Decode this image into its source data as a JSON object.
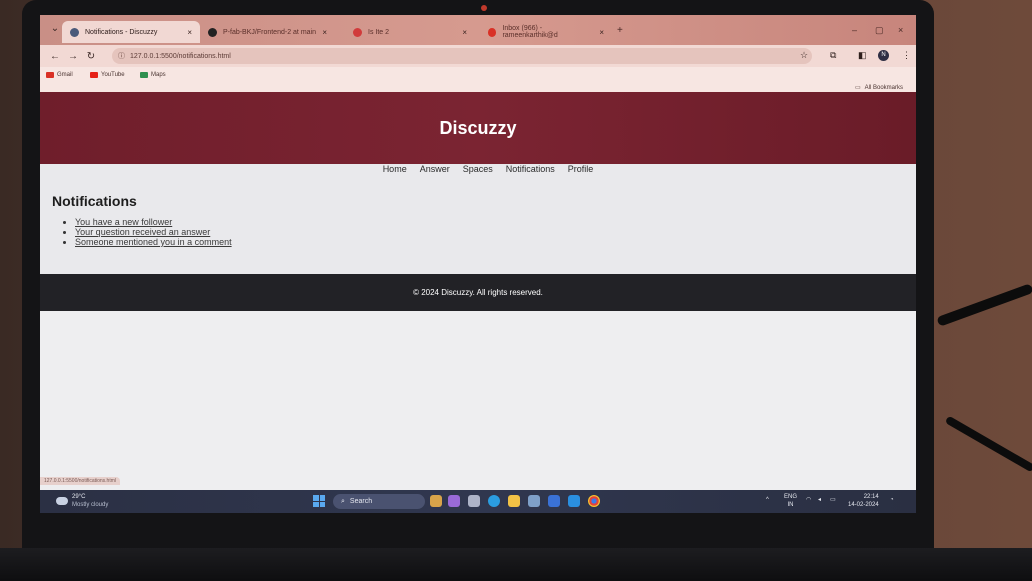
{
  "browser": {
    "tabs": [
      {
        "label": "Notifications - Discuzzy",
        "favicon_color": "#4a5a7a",
        "active": true
      },
      {
        "label": "P-fab-BKJ/Frontend-2 at main",
        "favicon_color": "#222222",
        "active": false
      },
      {
        "label": "Is Ite 2",
        "favicon_color": "#d13b3b",
        "active": false
      },
      {
        "label": "Inbox (966) - rameenkarthik@d",
        "favicon_color": "#d93025",
        "active": false
      }
    ],
    "url": "127.0.0.1:5500/notifications.html",
    "bookmarks": [
      {
        "label": "Gmail",
        "color": "#d93025"
      },
      {
        "label": "YouTube",
        "color": "#e62117"
      },
      {
        "label": "Maps",
        "color": "#2f8f4e"
      }
    ],
    "all_bookmarks_label": "All Bookmarks",
    "profile_initial": "N",
    "status_url": "127.0.0.1:5500/notifications.html"
  },
  "site": {
    "title": "Discuzzy",
    "nav": [
      "Home",
      "Answer",
      "Spaces",
      "Notifications",
      "Profile"
    ],
    "heading": "Notifications",
    "notifications": [
      "You have a new follower",
      "Your question received an answer",
      "Someone mentioned you in a comment"
    ],
    "footer": "© 2024 Discuzzy. All rights reserved.",
    "header_color": "#7b2432",
    "footer_color": "#222226"
  },
  "taskbar": {
    "temperature": "29°C",
    "weather": "Mostly cloudy",
    "search_label": "Search",
    "language": "ENG",
    "region": "IN",
    "time": "22:14",
    "date": "14-02-2024"
  }
}
